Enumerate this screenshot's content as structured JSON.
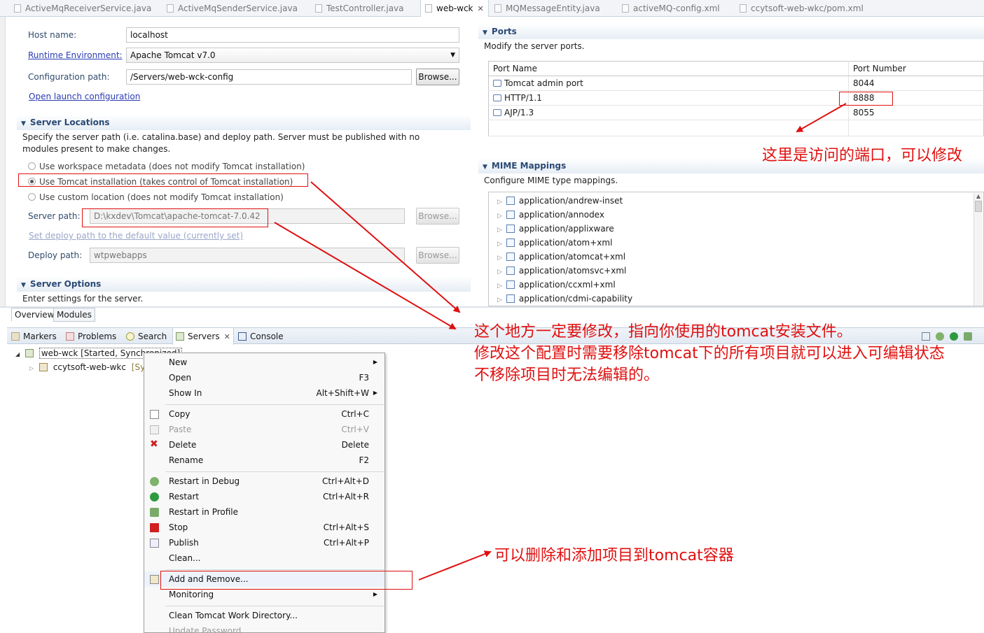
{
  "editor_tabs": [
    {
      "label": "ActiveMqReceiverService.java"
    },
    {
      "label": "ActiveMqSenderService.java"
    },
    {
      "label": "TestController.java"
    },
    {
      "label": "web-wck"
    },
    {
      "label": "MQMessageEntity.java"
    },
    {
      "label": "activeMQ-config.xml"
    },
    {
      "label": "ccytsoft-web-wkc/pom.xml"
    }
  ],
  "general": {
    "host_label": "Host name:",
    "host_value": "localhost",
    "runtime_label": "Runtime Environment:",
    "runtime_value": "Apache Tomcat v7.0",
    "config_label": "Configuration path:",
    "config_value": "/Servers/web-wck-config",
    "browse": "Browse...",
    "launch_link": "Open launch configuration"
  },
  "server_locations": {
    "title": "Server Locations",
    "description": "Specify the server path (i.e. catalina.base) and deploy path. Server must be published with no modules present to make changes.",
    "options": [
      "Use workspace metadata (does not modify Tomcat installation)",
      "Use Tomcat installation (takes control of Tomcat installation)",
      "Use custom location (does not modify Tomcat installation)"
    ],
    "server_path_label": "Server path:",
    "server_path_value": "D:\\kxdev\\Tomcat\\apache-tomcat-7.0.42",
    "set_deploy_link": "Set deploy path to the default value (currently set)",
    "deploy_path_label": "Deploy path:",
    "deploy_path_value": "wtpwebapps"
  },
  "server_options": {
    "title": "Server Options",
    "description": "Enter settings for the server."
  },
  "bottom_tabs": [
    "Overview",
    "Modules"
  ],
  "ports": {
    "title": "Ports",
    "description": "Modify the server ports.",
    "headers": [
      "Port Name",
      "Port Number"
    ],
    "rows": [
      {
        "name": "Tomcat admin port",
        "number": "8044"
      },
      {
        "name": "HTTP/1.1",
        "number": "8888"
      },
      {
        "name": "AJP/1.3",
        "number": "8055"
      }
    ]
  },
  "mime": {
    "title": "MIME Mappings",
    "description": "Configure MIME type mappings.",
    "items": [
      "application/andrew-inset",
      "application/annodex",
      "application/applixware",
      "application/atom+xml",
      "application/atomcat+xml",
      "application/atomsvc+xml",
      "application/ccxml+xml",
      "application/cdmi-capability"
    ]
  },
  "views": {
    "tabs": [
      "Markers",
      "Problems",
      "Search",
      "Servers",
      "Console"
    ],
    "server_node": "web-wck  [Started, Synchronized]",
    "project_node": "ccytsoft-web-wkc",
    "project_suffix": "[Sy"
  },
  "context_menu": {
    "items": [
      {
        "label": "New",
        "shortcut": "",
        "submenu": true
      },
      {
        "label": "Open",
        "shortcut": "F3"
      },
      {
        "label": "Show In",
        "shortcut": "Alt+Shift+W",
        "submenu": true
      },
      {
        "label": "Copy",
        "shortcut": "Ctrl+C"
      },
      {
        "label": "Paste",
        "shortcut": "Ctrl+V",
        "disabled": true
      },
      {
        "label": "Delete",
        "shortcut": "Delete"
      },
      {
        "label": "Rename",
        "shortcut": "F2"
      },
      {
        "label": "Restart in Debug",
        "shortcut": "Ctrl+Alt+D"
      },
      {
        "label": "Restart",
        "shortcut": "Ctrl+Alt+R"
      },
      {
        "label": "Restart in Profile",
        "shortcut": ""
      },
      {
        "label": "Stop",
        "shortcut": "Ctrl+Alt+S"
      },
      {
        "label": "Publish",
        "shortcut": "Ctrl+Alt+P"
      },
      {
        "label": "Clean...",
        "shortcut": ""
      },
      {
        "label": "Add and Remove...",
        "shortcut": ""
      },
      {
        "label": "Monitoring",
        "shortcut": "",
        "submenu": true
      },
      {
        "label": "Clean Tomcat Work Directory...",
        "shortcut": ""
      },
      {
        "label": "Update Password...",
        "shortcut": "",
        "disabled": true
      }
    ]
  },
  "annotations": {
    "port_note": "这里是访问的端口，可以修改",
    "tomcat_note_1": "这个地方一定要修改，指向你使用的tomcat安装文件。",
    "tomcat_note_2": "修改这个配置时需要移除tomcat下的所有项目就可以进入可编辑状态",
    "tomcat_note_3": "不移除项目时无法编辑的。",
    "add_remove_note": "可以删除和添加项目到tomcat容器",
    "color": "#e01010"
  }
}
